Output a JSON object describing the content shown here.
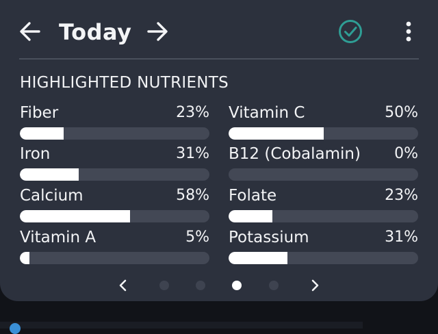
{
  "header": {
    "title": "Today",
    "back_icon": "arrow-left-icon",
    "forward_icon": "arrow-right-icon",
    "done_icon": "check-circle-icon",
    "menu_icon": "more-vertical-icon"
  },
  "section": {
    "title": "HIGHLIGHTED NUTRIENTS"
  },
  "nutrients": [
    {
      "name": "Fiber",
      "percent_label": "23%",
      "percent": 23
    },
    {
      "name": "Vitamin C",
      "percent_label": "50%",
      "percent": 50
    },
    {
      "name": "Iron",
      "percent_label": "31%",
      "percent": 31
    },
    {
      "name": "B12 (Cobalamin)",
      "percent_label": "0%",
      "percent": 0
    },
    {
      "name": "Calcium",
      "percent_label": "58%",
      "percent": 58
    },
    {
      "name": "Folate",
      "percent_label": "23%",
      "percent": 23
    },
    {
      "name": "Vitamin A",
      "percent_label": "5%",
      "percent": 5
    },
    {
      "name": "Potassium",
      "percent_label": "31%",
      "percent": 31
    }
  ],
  "pager": {
    "page_count": 4,
    "active_page": 3,
    "prev_icon": "chevron-left-icon",
    "next_icon": "chevron-right-icon"
  },
  "colors": {
    "card_bg": "#2c313d",
    "accent_check": "#2f9e95",
    "bar_fill": "#ffffff",
    "bar_track": "#434855"
  }
}
